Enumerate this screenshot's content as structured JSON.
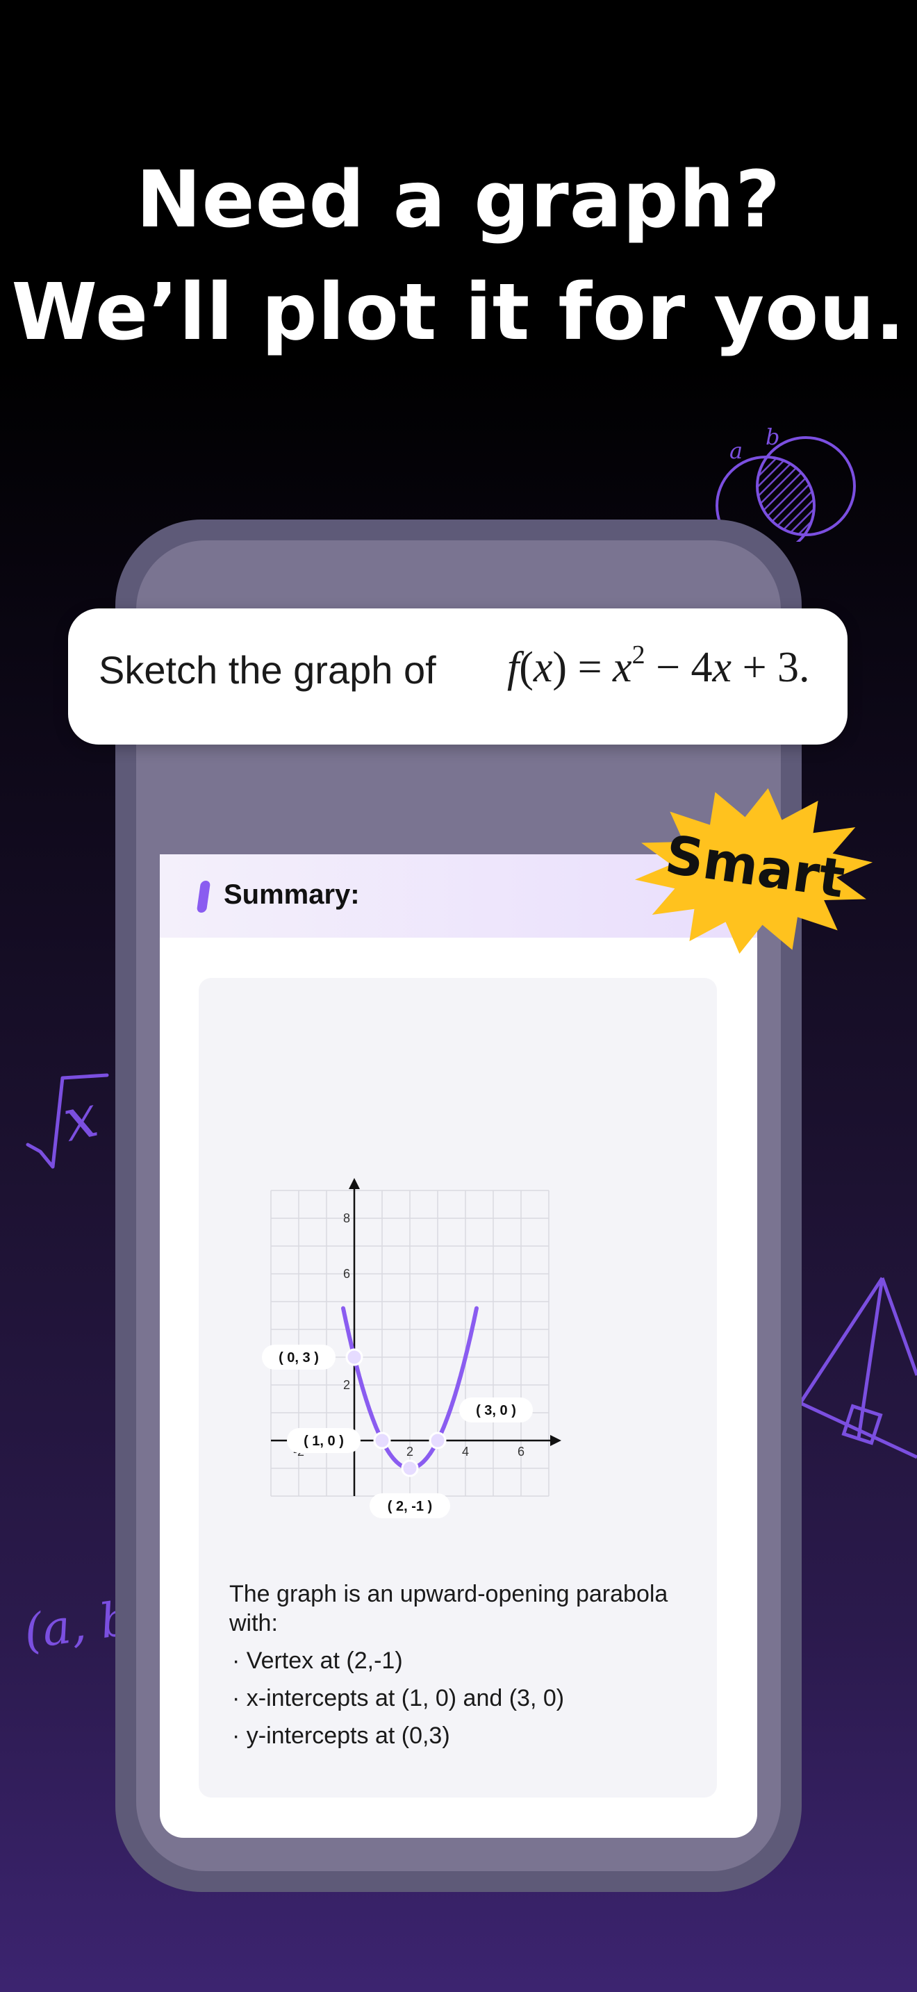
{
  "headline": {
    "line1": "Need a graph?",
    "line2": "We’ll plot it for you."
  },
  "prompt": {
    "text": "Sketch the graph of",
    "math": {
      "f": "f",
      "x": "x",
      "rest": "− 4",
      "exponent": "2",
      "tail": "+ 3."
    }
  },
  "badge": {
    "label": "Smart",
    "color": "#ffc21e"
  },
  "summary": {
    "title": "Summary:",
    "accent_color": "#8a5cf0",
    "description": {
      "line1": "The graph is an upward-opening parabola",
      "line2": "with:",
      "bullets": [
        "· Vertex at (2,-1)",
        "· x-intercepts at (1, 0) and (3, 0)",
        "· y-intercepts at (0,3)"
      ]
    }
  },
  "decorations": {
    "icons": [
      "venn-diagram-icon",
      "sqrt-x-icon",
      "triangle-icon",
      "ab-pair-icon"
    ],
    "sqrt_label": "x",
    "venn_labels": [
      "a",
      "b"
    ],
    "pair_label": "(a, b"
  },
  "chart_data": {
    "type": "line",
    "function": "f(x) = x^2 - 4x + 3",
    "xlim": [
      -3,
      7
    ],
    "ylim": [
      -2,
      9
    ],
    "grid": true,
    "x_ticks": [
      -2,
      2,
      4,
      6
    ],
    "y_ticks": [
      2,
      6,
      8
    ],
    "line_color": "#8a5cf0",
    "series": [
      {
        "x": [
          -0.4,
          0,
          0.5,
          1,
          1.5,
          2,
          2.5,
          3,
          3.5,
          4,
          4.4
        ],
        "y": [
          4.76,
          3,
          1.25,
          0,
          -0.75,
          -1,
          -0.75,
          0,
          1.25,
          3,
          4.76
        ]
      }
    ],
    "points": [
      {
        "x": 0,
        "y": 3,
        "label": "( 0, 3 )"
      },
      {
        "x": 1,
        "y": 0,
        "label": "( 1, 0 )"
      },
      {
        "x": 2,
        "y": -1,
        "label": "( 2, -1 )"
      },
      {
        "x": 3,
        "y": 0,
        "label": "( 3, 0 )"
      }
    ]
  }
}
